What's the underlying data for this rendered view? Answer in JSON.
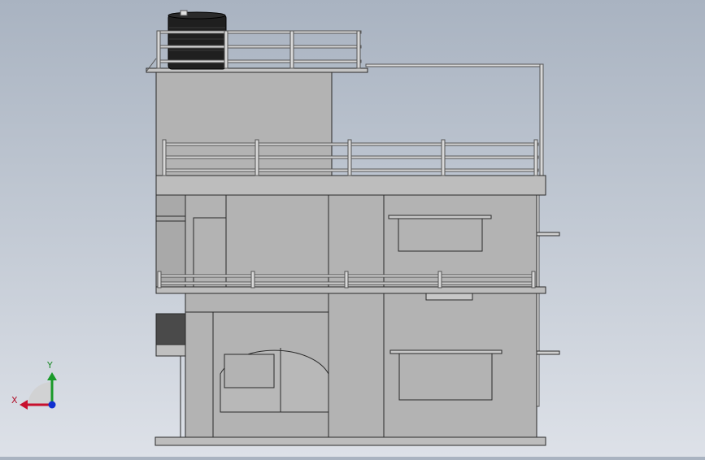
{
  "triad": {
    "x_label": "X",
    "y_label": "Y",
    "x_color": "#c8102e",
    "y_color": "#1a9a2a",
    "z_color": "#1030d0"
  },
  "colors": {
    "wall": "#b3b3b3",
    "edge": "#2a2a2a",
    "rail": "#d8d8d8",
    "tank": "#1f1f1f",
    "dark_panel": "#4a4a4a"
  }
}
